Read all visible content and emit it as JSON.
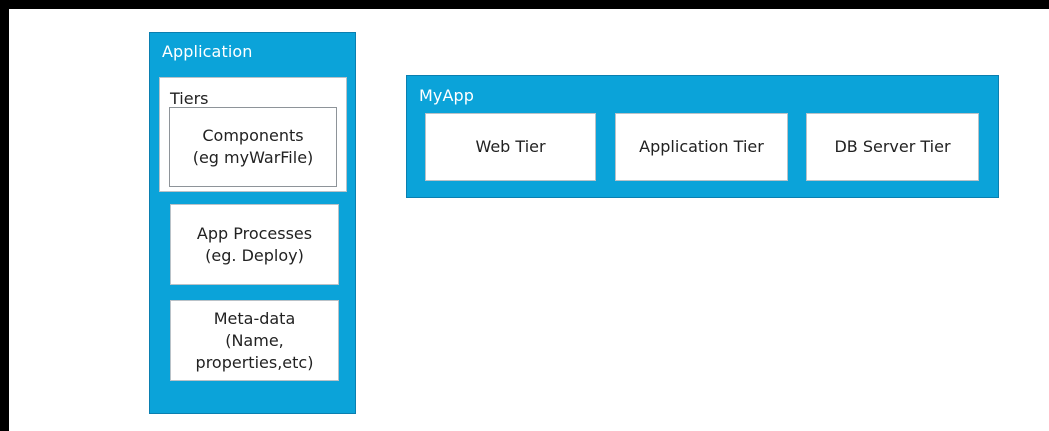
{
  "application": {
    "title": "Application",
    "tiers": {
      "label": "Tiers",
      "components": "Components\n(eg myWarFile)"
    },
    "app_processes": "App Processes\n(eg. Deploy)",
    "meta_data": "Meta-data\n(Name,\nproperties,etc)"
  },
  "myapp": {
    "title": "MyApp",
    "tiers": [
      "Web Tier",
      "Application Tier",
      "DB Server Tier"
    ]
  },
  "colors": {
    "panel_blue": "#0ba3d9",
    "background": "#ffffff",
    "border": "#000000"
  }
}
